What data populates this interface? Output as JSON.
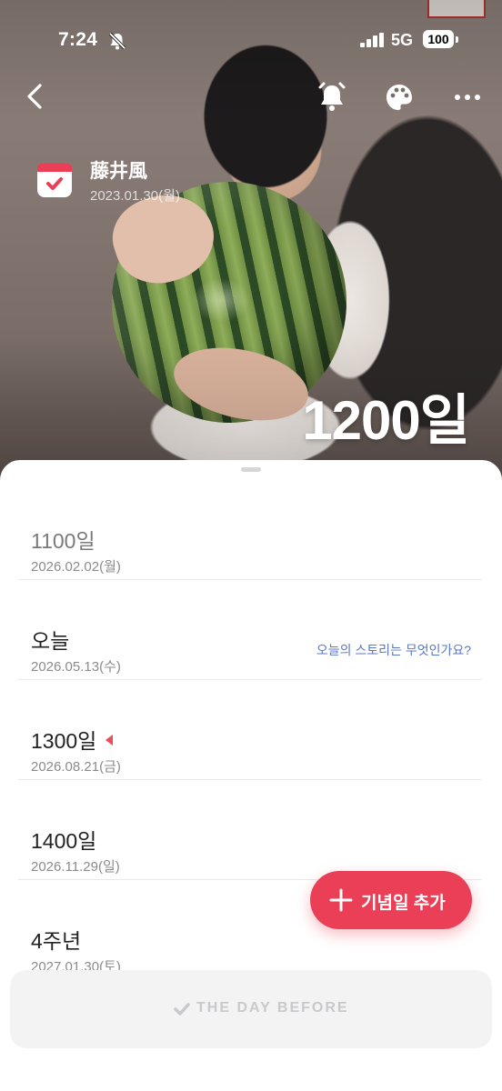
{
  "status_bar": {
    "time": "7:24",
    "network": "5G",
    "battery": "100"
  },
  "event": {
    "title": "藤井風",
    "start_date": "2023.01.30(월)",
    "big_count": "1200일"
  },
  "milestones": [
    {
      "label": "1100일",
      "date": "2026.02.02(월)"
    },
    {
      "label": "오늘",
      "date": "2026.05.13(수)",
      "link": "오늘의 스토리는 무엇인가요?"
    },
    {
      "label": "1300일",
      "date": "2026.08.21(금)"
    },
    {
      "label": "1400일",
      "date": "2026.11.29(일)"
    },
    {
      "label": "4주년",
      "date": "2027.01.30(토)"
    }
  ],
  "fab": {
    "label": "기념일 추가"
  },
  "banner": {
    "text": "THE DAY BEFORE"
  },
  "colors": {
    "accent": "#ea3f57",
    "link": "#5a78c8",
    "next_marker": "#ec4c5c"
  },
  "icons": {
    "back": "chevron-left-icon",
    "alarm": "bell-icon",
    "palette": "palette-icon",
    "more": "more-horizontal-icon",
    "calendar": "calendar-check-icon",
    "add": "plus-icon"
  }
}
